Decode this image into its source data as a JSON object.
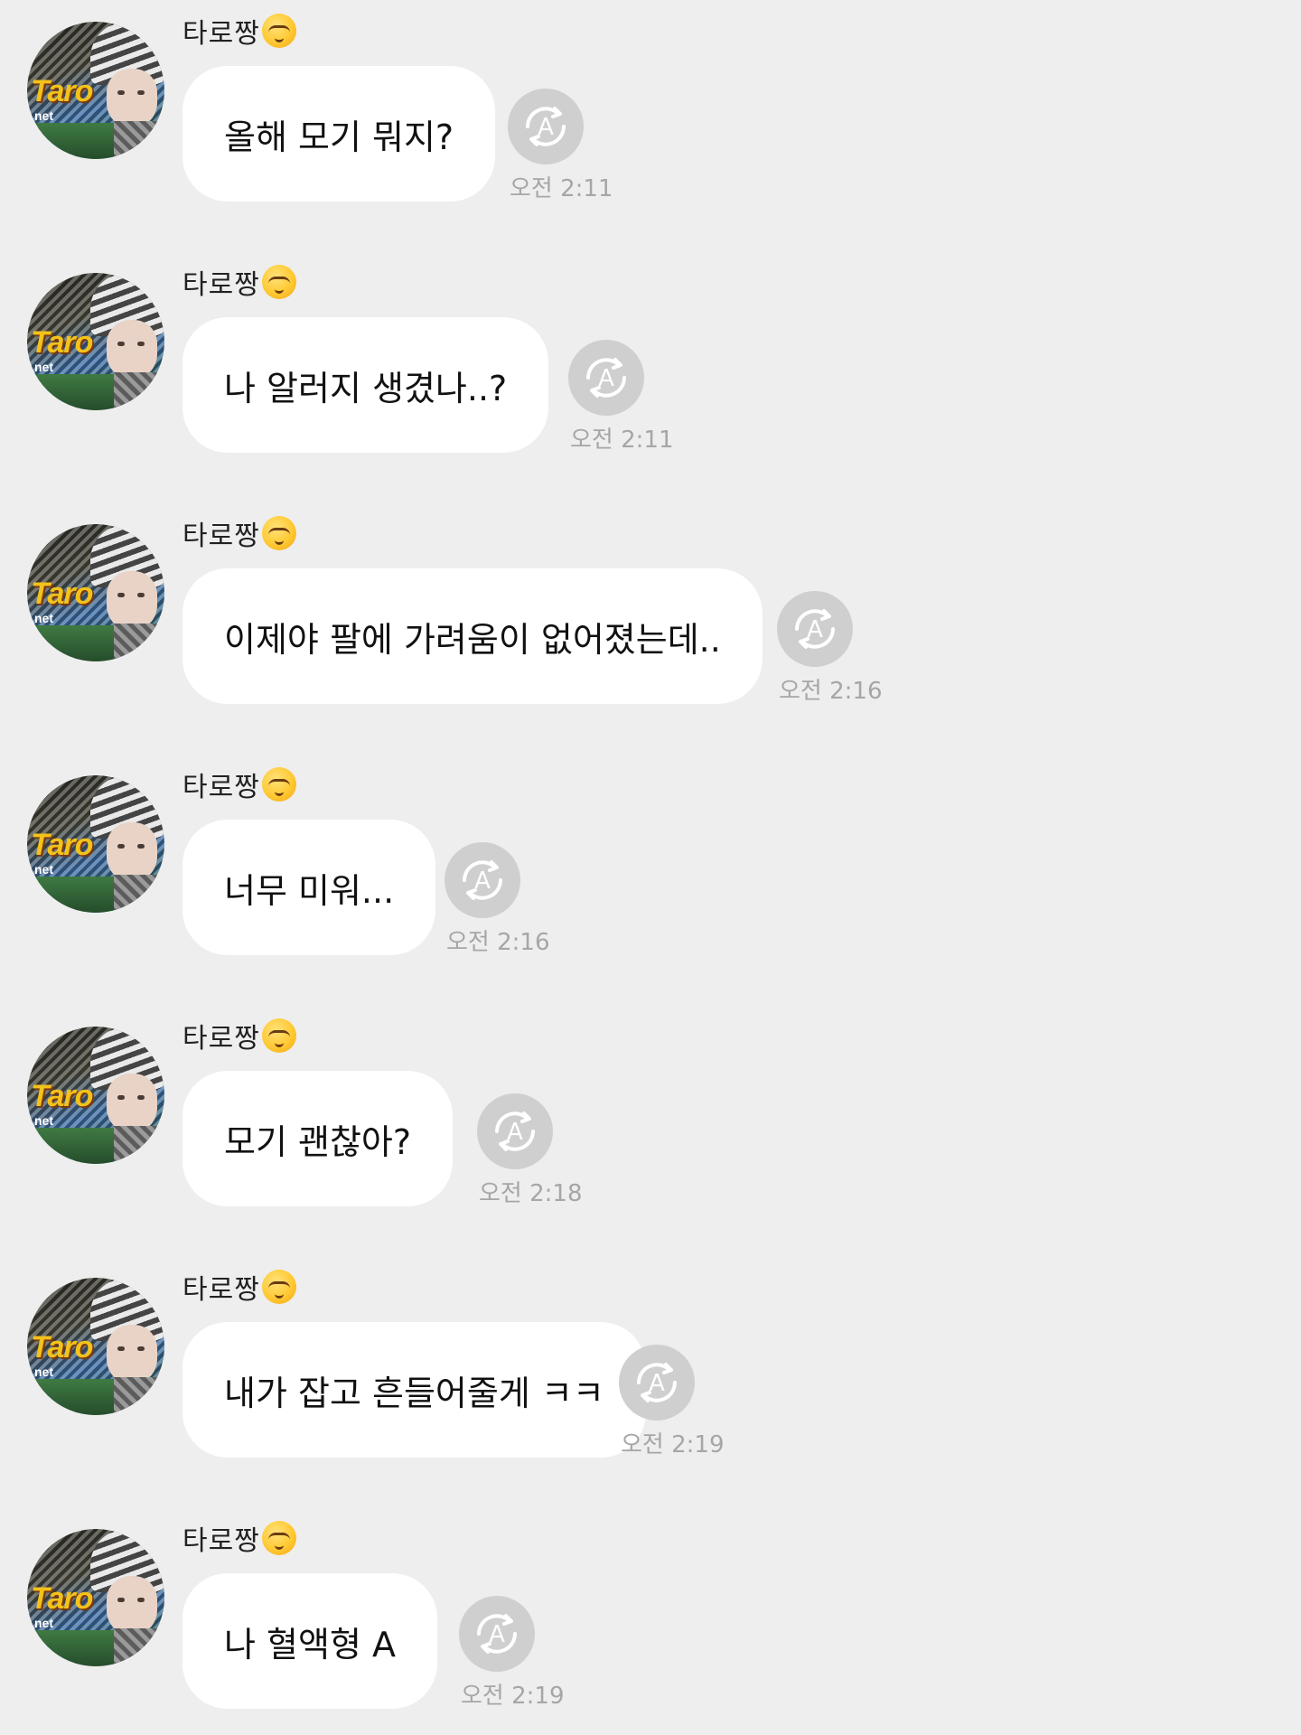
{
  "chat": {
    "messages": [
      {
        "sender": "타로짱",
        "text": "올해 모기 뭐지?",
        "time": "오전 2:11"
      },
      {
        "sender": "타로짱",
        "text": "나 알러지 생겼나..?",
        "time": "오전 2:11"
      },
      {
        "sender": "타로짱",
        "text": "이제야 팔에 가려움이 없어졌는데..",
        "time": "오전 2:16"
      },
      {
        "sender": "타로짱",
        "text": "너무 미워...",
        "time": "오전 2:16"
      },
      {
        "sender": "타로짱",
        "text": "모기 괜찮아?",
        "time": "오전 2:18"
      },
      {
        "sender": "타로짱",
        "text": "내가 잡고 흔들어줄게 ㅋㅋ",
        "time": "오전 2:19"
      },
      {
        "sender": "타로짱",
        "text": "나 혈액형 A",
        "time": "오전 2:19"
      }
    ],
    "avatar_logo": "Taro",
    "avatar_logo_sub": "net",
    "sender_emoji": "smirking-face-icon",
    "read_icon": "auto-translate-icon",
    "read_icon_letter": "A"
  },
  "colors": {
    "background": "#eeeeee",
    "bubble": "#ffffff",
    "time_text": "#a6a6a6",
    "read_icon_bg": "#cfcfcf"
  }
}
